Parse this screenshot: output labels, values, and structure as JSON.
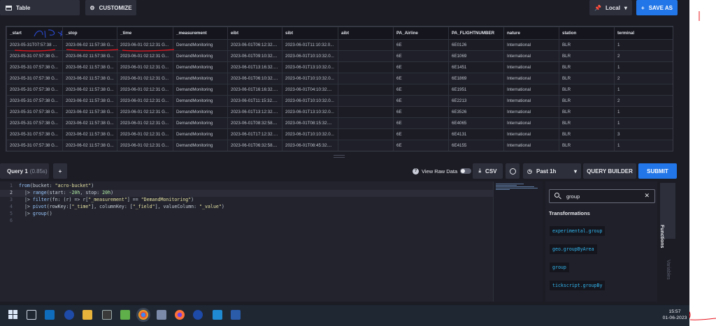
{
  "header": {
    "view_select": "Table",
    "customize_label": "CUSTOMIZE",
    "timezone_label": "Local",
    "save_as_label": "SAVE AS"
  },
  "table": {
    "columns": [
      "_start",
      "_stop",
      "_time",
      "_measurement",
      "eibt",
      "sibt",
      "aibt",
      "PA_Airline",
      "PA_FLIGHTNUMBER",
      "nature",
      "station",
      "terminal"
    ],
    "rows": [
      [
        "2023-05-31T07:57:38 G...",
        "2023-06-02 11:57:38 G...",
        "2023-06-01 02:12:31 G...",
        "DemandMonitoring",
        "2023-06-01T06:12:32....",
        "2023-06-01T11:10:32.0...",
        "",
        "6E",
        "6E0126",
        "International",
        "BLR",
        "1"
      ],
      [
        "2023-05-31 07:57:38 G...",
        "2023-06-02 11:57:38 G...",
        "2023-06-01 02:12:31 G...",
        "DemandMonitoring",
        "2023-06-01T09:10:32....",
        "2023-06-01T10:10:32.0...",
        "",
        "6E",
        "6E1069",
        "International",
        "BLR",
        "2"
      ],
      [
        "2023-05-31 07:57:38 G...",
        "2023-06-02 11:57:38 G...",
        "2023-06-01 02:12:31 G...",
        "DemandMonitoring",
        "2023-06-01T13:16:32.0...",
        "2023-06-01T13:10:32.0...",
        "",
        "6E",
        "6E1451",
        "International",
        "BLR",
        "1"
      ],
      [
        "2023-05-31 07:57:38 G...",
        "2023-06-02 11:57:38 G...",
        "2023-06-01 02:12:31 G...",
        "DemandMonitoring",
        "2023-06-01T06:10:32.0...",
        "2023-06-01T10:10:32.0...",
        "",
        "6E",
        "6E1869",
        "International",
        "BLR",
        "2"
      ],
      [
        "2023-05-31 07:57:38 G...",
        "2023-06-02 11:57:38 G...",
        "2023-06-01 02:12:31 G...",
        "DemandMonitoring",
        "2023-06-01T16:16:32.0...",
        "2023-06-01T04:10:32....",
        "",
        "6E",
        "6E1951",
        "International",
        "BLR",
        "1"
      ],
      [
        "2023-05-31 07:57:38 G...",
        "2023-06-02 11:57:38 G...",
        "2023-06-01 02:12:31 G...",
        "DemandMonitoring",
        "2023-06-01T11:15:32.0...",
        "2023-06-01T10:10:32.0...",
        "",
        "6E",
        "6E2213",
        "International",
        "BLR",
        "2"
      ],
      [
        "2023-05-31 07:57:38 G...",
        "2023-06-02 11:57:38 G...",
        "2023-06-01 02:12:31 G...",
        "DemandMonitoring",
        "2023-06-01T13:12:32.0...",
        "2023-06-01T13:10:32.0...",
        "",
        "6E",
        "6E3526",
        "International",
        "BLR",
        "1"
      ],
      [
        "2023-05-31 07:57:38 G...",
        "2023-06-02 11:57:38 G...",
        "2023-06-01 02:12:31 G...",
        "DemandMonitoring",
        "2023-06-01T08:32:58....",
        "2023-06-01T08:15:32....",
        "",
        "6E",
        "6E4065",
        "International",
        "BLR",
        "1"
      ],
      [
        "2023-05-31 07:57:38 G...",
        "2023-06-02 11:57:38 G...",
        "2023-06-01 02:12:31 G...",
        "DemandMonitoring",
        "2023-06-01T17:12:32.0...",
        "2023-06-01T10:10:32.0...",
        "",
        "6E",
        "6E4131",
        "International",
        "BLR",
        "3"
      ],
      [
        "2023-05-31 07:57:38 G...",
        "2023-06-02 11:57:38 G...",
        "2023-06-01 02:12:31 G...",
        "DemandMonitoring",
        "2023-06-01T06:32:58....",
        "2023-06-01T08:45:32....",
        "",
        "6E",
        "6E4155",
        "International",
        "BLR",
        "1"
      ]
    ]
  },
  "querybar": {
    "tab_label": "Query 1",
    "tab_time": "(0.85s)",
    "add_label": "+",
    "view_raw_label": "View Raw Data",
    "csv_label": "CSV",
    "time_range": "Past 1h",
    "query_builder_label": "QUERY BUILDER",
    "submit_label": "SUBMIT"
  },
  "editor": {
    "line_numbers": [
      "1",
      "2",
      "3",
      "4",
      "5",
      "6"
    ]
  },
  "functions_panel": {
    "search_value": "group",
    "section_title": "Transformations",
    "items": [
      "experimental.group",
      "geo.groupByArea",
      "group",
      "tickscript.groupBy"
    ],
    "tab_functions": "Functions",
    "tab_variables": "Variables"
  },
  "taskbar": {
    "time": "15:57",
    "date": "01-06-2023"
  },
  "colors": {
    "accent_blue": "#2276e8",
    "annotation_red": "#e8141e",
    "annotation_blue": "#2d4ee0",
    "function_cyan": "#33b5f0"
  }
}
